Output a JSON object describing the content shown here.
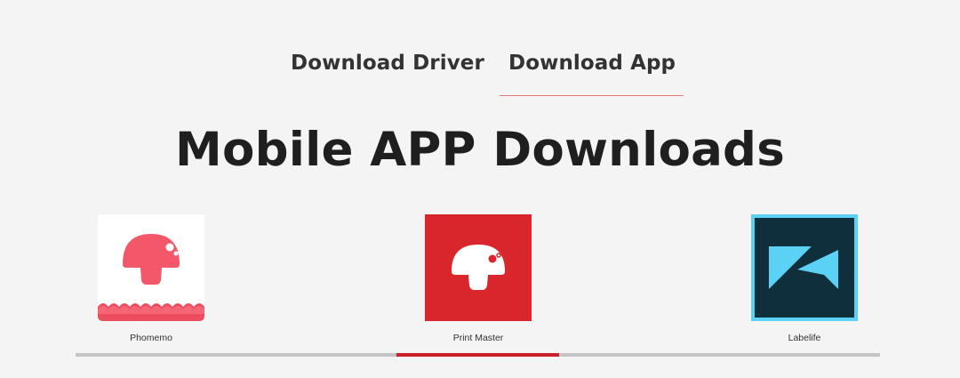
{
  "tabs": {
    "driver_label": "Download Driver",
    "app_label": "Download App",
    "active": "Download App"
  },
  "heading": "Mobile APP Downloads",
  "apps": [
    {
      "name": "Phomemo",
      "icon": "phomemo-mushroom-icon",
      "color": "#f2576a"
    },
    {
      "name": "Print Master",
      "icon": "print-master-mushroom-icon",
      "color": "#d9262c"
    },
    {
      "name": "Labelife",
      "icon": "labelife-logo-icon",
      "color": "#0e2f3b"
    }
  ],
  "carousel": {
    "active_index": 1,
    "track_color": "#c4c4c4",
    "thumb_color": "#c8202a"
  }
}
